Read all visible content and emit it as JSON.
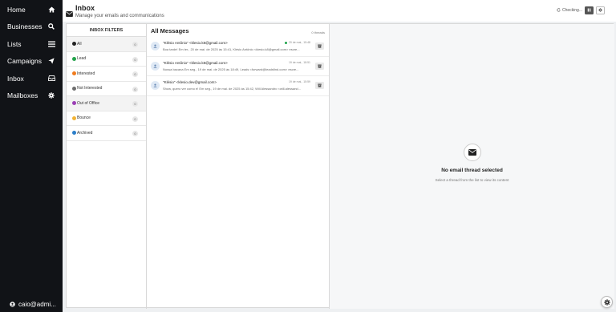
{
  "sidebar": {
    "items": [
      {
        "label": "Home",
        "icon": "home-icon"
      },
      {
        "label": "Businesses",
        "icon": "search-icon"
      },
      {
        "label": "Lists",
        "icon": "list-icon"
      },
      {
        "label": "Campaigns",
        "icon": "send-icon"
      },
      {
        "label": "Inbox",
        "icon": "inbox-icon"
      },
      {
        "label": "Mailboxes",
        "icon": "gear-icon"
      }
    ],
    "user": "caio@admi..."
  },
  "header": {
    "title": "Inbox",
    "subtitle": "Manage your emails and communications",
    "status": "Checking..."
  },
  "filters": {
    "heading": "INBOX FILTERS",
    "items": [
      {
        "label": "All",
        "count": "0",
        "color": "#222222"
      },
      {
        "label": "Lead",
        "count": "0",
        "color": "#22a24a"
      },
      {
        "label": "Interested",
        "count": "0",
        "color": "#f07b1e"
      },
      {
        "label": "Not Interested",
        "count": "0",
        "color": "#6d6d6d"
      },
      {
        "label": "Out of Office",
        "count": "0",
        "color": "#9b3fb5"
      },
      {
        "label": "Bounce",
        "count": "0",
        "color": "#f2b233"
      },
      {
        "label": "Archived",
        "count": "0",
        "color": "#2b7ec9"
      }
    ]
  },
  "messages": {
    "heading": "All Messages",
    "count": "0 threads",
    "threads": [
      {
        "from": "\"Klésio Antônio\" <klesio.k8@gmail.com>",
        "preview": "Boa tarde! Em ter., 20 de mai. de 2025 às 15:41, Klésio Antônio <klesio.k8@gmail.com> escre...",
        "date": "20 de mai., 15:48",
        "unread": true
      },
      {
        "from": "\"Klésio Antônio\" <klesio.k8@gmail.com>",
        "preview": "Nossa bacana Em seg., 19 de mai. de 2025 às 18:49, Leads <forward@leadsfind.com> escre...",
        "date": "19 de mai., 18:51",
        "unread": false
      },
      {
        "from": "\"Klésio\" <klesio.dev@gmail.com>",
        "preview": "Show, quero ver como é! Em seg., 19 de mai. de 2025 às 15:42, Will Alessandro <will.alessand...",
        "date": "19 de mai., 15:59",
        "unread": false
      }
    ]
  },
  "empty": {
    "title": "No email thread selected",
    "subtitle": "Select a thread from the list to view its content"
  }
}
